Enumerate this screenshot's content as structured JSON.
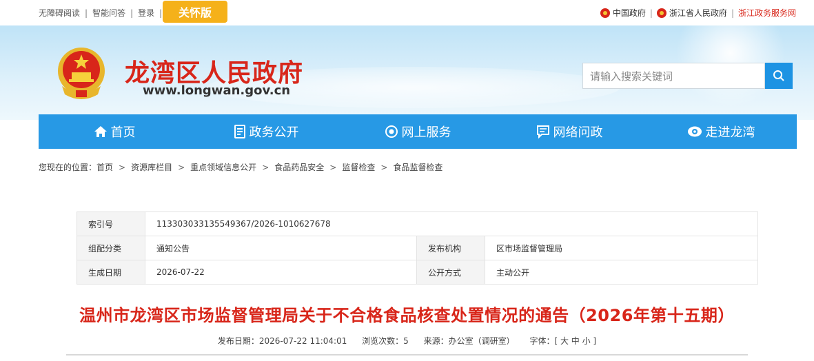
{
  "top": {
    "links": [
      "无障碍阅读",
      "智能问答",
      "登录"
    ],
    "care_label": "关怀版",
    "right_links": [
      "中国政府",
      "浙江省人民政府",
      "浙江政务服务网"
    ]
  },
  "header": {
    "title": "龙湾区人民政府",
    "url": "www.longwan.gov.cn",
    "search_placeholder": "请输入搜索关键词"
  },
  "nav": [
    {
      "label": "首页",
      "icon": "home-icon"
    },
    {
      "label": "政务公开",
      "icon": "document-icon"
    },
    {
      "label": "网上服务",
      "icon": "service-icon"
    },
    {
      "label": "网络问政",
      "icon": "chat-icon"
    },
    {
      "label": "走进龙湾",
      "icon": "eye-icon"
    }
  ],
  "breadcrumb": {
    "prefix": "您现在的位置：",
    "items": [
      "首页",
      "资源库栏目",
      "重点领域信息公开",
      "食品药品安全",
      "监督检查",
      "食品监督检查"
    ]
  },
  "info": {
    "index_key": "索引号",
    "index_val": "113303033135549367/2026-1010627678",
    "category_key": "组配分类",
    "category_val": "通知公告",
    "publisher_key": "发布机构",
    "publisher_val": "区市场监督管理局",
    "date_key": "生成日期",
    "date_val": "2026-07-22",
    "mode_key": "公开方式",
    "mode_val": "主动公开"
  },
  "article": {
    "title": "温州市龙湾区市场监督管理局关于不合格食品核查处置情况的通告（2026年第十五期）",
    "publish_date": "发布日期：2026-07-22 11:04:01",
    "views": "浏览次数：5",
    "source": "来源：办公室（调研室）",
    "font_size": "字体：[ 大 中 小 ]"
  },
  "colors": {
    "brand_red": "#d8261a",
    "nav_blue": "#2799e5",
    "care_orange": "#f5b11a"
  }
}
